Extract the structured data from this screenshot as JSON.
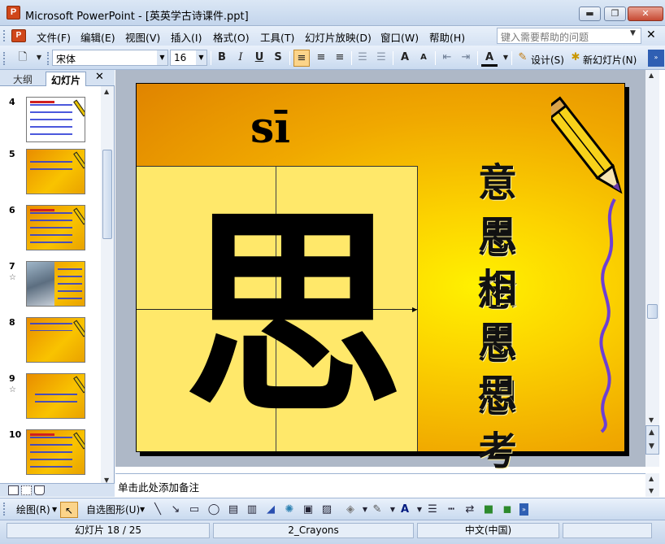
{
  "window": {
    "title": "Microsoft PowerPoint - [英英学古诗课件.ppt]",
    "app_badge": "P",
    "minimize": "▬",
    "maximize": "❐",
    "close": "✕"
  },
  "menu": {
    "items": [
      "文件(F)",
      "编辑(E)",
      "视图(V)",
      "插入(I)",
      "格式(O)",
      "工具(T)",
      "幻灯片放映(D)",
      "窗口(W)",
      "帮助(H)"
    ],
    "help_placeholder": "键入需要帮助的问题",
    "close_label": "✕"
  },
  "toolbar": {
    "font_name": "宋体",
    "font_size": "16",
    "bold": "B",
    "italic": "I",
    "underline": "U",
    "shadow": "S",
    "grow_font": "A",
    "shrink_font": "A",
    "font_color": "A",
    "design_label": "设计(S)",
    "new_slide_label": "新幻灯片(N)"
  },
  "outline_pane": {
    "tab_outline": "大纲",
    "tab_slides": "幻灯片",
    "close": "✕",
    "thumbnails": [
      {
        "number": "4",
        "star": ""
      },
      {
        "number": "5",
        "star": ""
      },
      {
        "number": "6",
        "star": ""
      },
      {
        "number": "7",
        "star": "☆"
      },
      {
        "number": "8",
        "star": ""
      },
      {
        "number": "9",
        "star": "☆"
      },
      {
        "number": "10",
        "star": ""
      }
    ]
  },
  "slide": {
    "pinyin": "sī",
    "big_character": "思",
    "words": [
      "意思",
      "思念",
      "相思",
      "思想",
      "思考"
    ]
  },
  "notes": {
    "placeholder": "单击此处添加备注"
  },
  "drawing_toolbar": {
    "draw_label": "绘图(R)",
    "autoshapes_label": "自选图形(U)"
  },
  "status": {
    "slide_position": "幻灯片 18 / 25",
    "design_template": "2_Crayons",
    "language": "中文(中国)"
  },
  "colors": {
    "accent_selected": "#fbd48a",
    "slide_orange": "#e08400",
    "slide_yellow": "#fff100",
    "word_shadow": "#fff3a0"
  }
}
